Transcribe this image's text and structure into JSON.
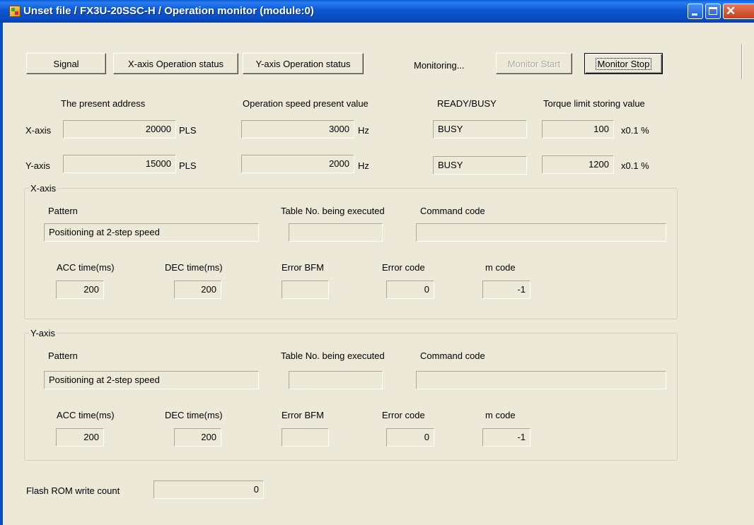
{
  "window": {
    "title": "Unset file / FX3U-20SSC-H / Operation monitor (module:0)",
    "controls": {
      "minimize": "minimize-icon",
      "maximize": "maximize-icon",
      "close": "close-icon"
    },
    "close_glyph": "✕"
  },
  "toolbar": {
    "signal": "Signal",
    "x_status": "X-axis Operation status",
    "y_status": "Y-axis Operation status",
    "monitoring": "Monitoring...",
    "monitor_start": "Monitor Start",
    "monitor_stop": "Monitor Stop"
  },
  "present": {
    "headers": {
      "address": "The present address",
      "speed": "Operation speed present value",
      "ready": "READY/BUSY",
      "torque": "Torque limit storing value"
    },
    "rows": [
      {
        "label": "X-axis",
        "address": "20000",
        "address_unit": "PLS",
        "speed": "3000",
        "speed_unit": "Hz",
        "ready": "BUSY",
        "torque": "100",
        "torque_unit": "x0.1 %"
      },
      {
        "label": "Y-axis",
        "address": "15000",
        "address_unit": "PLS",
        "speed": "2000",
        "speed_unit": "Hz",
        "ready": "BUSY",
        "torque": "1200",
        "torque_unit": "x0.1 %"
      }
    ]
  },
  "axes": [
    {
      "title": "X-axis",
      "pattern_label": "Pattern",
      "pattern": "Positioning at 2-step speed",
      "table_label": "Table No. being executed",
      "table": "",
      "command_label": "Command code",
      "command": "",
      "acc_label": "ACC time(ms)",
      "acc": "200",
      "dec_label": "DEC time(ms)",
      "dec": "200",
      "err_bfm_label": "Error BFM",
      "err_bfm": "",
      "err_code_label": "Error code",
      "err_code": "0",
      "mcode_label": "m code",
      "mcode": "-1"
    },
    {
      "title": "Y-axis",
      "pattern_label": "Pattern",
      "pattern": "Positioning at 2-step speed",
      "table_label": "Table No. being executed",
      "table": "",
      "command_label": "Command code",
      "command": "",
      "acc_label": "ACC time(ms)",
      "acc": "200",
      "dec_label": "DEC time(ms)",
      "dec": "200",
      "err_bfm_label": "Error BFM",
      "err_bfm": "",
      "err_code_label": "Error code",
      "err_code": "0",
      "mcode_label": "m code",
      "mcode": "-1"
    }
  ],
  "flash": {
    "label": "Flash ROM write count",
    "value": "0"
  }
}
